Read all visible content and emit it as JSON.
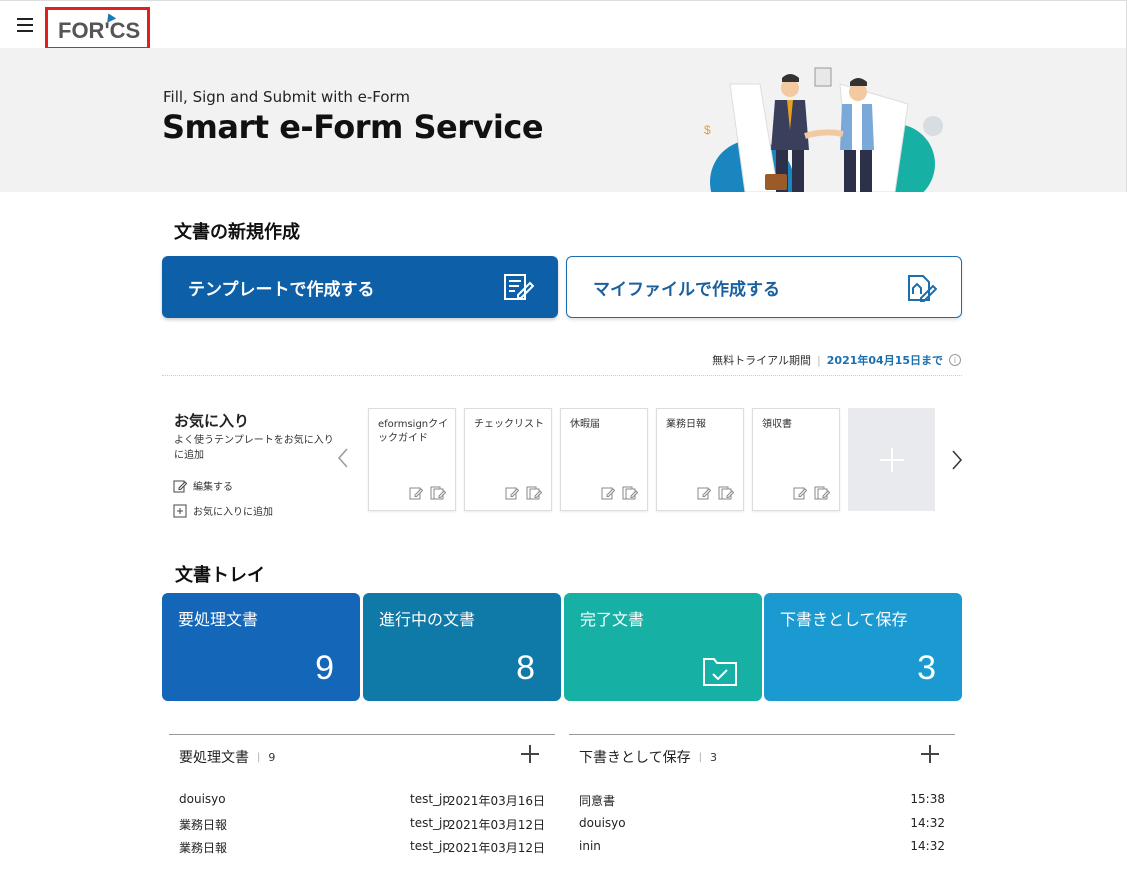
{
  "header": {
    "logo_text": "FOR'CS"
  },
  "hero": {
    "subtitle": "Fill, Sign and Submit with e-Form",
    "title": "Smart e-Form Service"
  },
  "create": {
    "title": "文書の新規作成",
    "template_label": "テンプレートで作成する",
    "myfile_label": "マイファイルで作成する"
  },
  "trial": {
    "label": "無料トライアル期間",
    "date": "2021年04月15日まで",
    "info": "i"
  },
  "favorites": {
    "title": "お気に入り",
    "description": "よく使うテンプレートをお気に入りに追加",
    "edit_label": "編集する",
    "add_label": "お気に入りに追加",
    "items": [
      {
        "label": "eformsignクイックガイド"
      },
      {
        "label": "チェックリスト"
      },
      {
        "label": "休暇届"
      },
      {
        "label": "業務日報"
      },
      {
        "label": "領収書"
      }
    ]
  },
  "tray": {
    "title": "文書トレイ",
    "boxes": [
      {
        "label": "要処理文書",
        "count": "9",
        "color": "#1466b8"
      },
      {
        "label": "進行中の文書",
        "count": "8",
        "color": "#0f7aa8"
      },
      {
        "label": "完了文書",
        "count": "",
        "color": "#17b0a4"
      },
      {
        "label": "下書きとして保存",
        "count": "3",
        "color": "#1a9ad0"
      }
    ]
  },
  "lists": {
    "pending": {
      "title": "要処理文書",
      "count": "9",
      "rows": [
        {
          "title": "douisyo",
          "user": "test_jp",
          "date": "2021年03月16日"
        },
        {
          "title": "業務日報",
          "user": "test_jp",
          "date": "2021年03月12日"
        },
        {
          "title": "業務日報",
          "user": "test_jp",
          "date": "2021年03月12日"
        }
      ]
    },
    "drafts": {
      "title": "下書きとして保存",
      "count": "3",
      "rows": [
        {
          "title": "同意書",
          "time": "15:38"
        },
        {
          "title": "douisyo",
          "time": "14:32"
        },
        {
          "title": "inin",
          "time": "14:32"
        }
      ]
    }
  }
}
